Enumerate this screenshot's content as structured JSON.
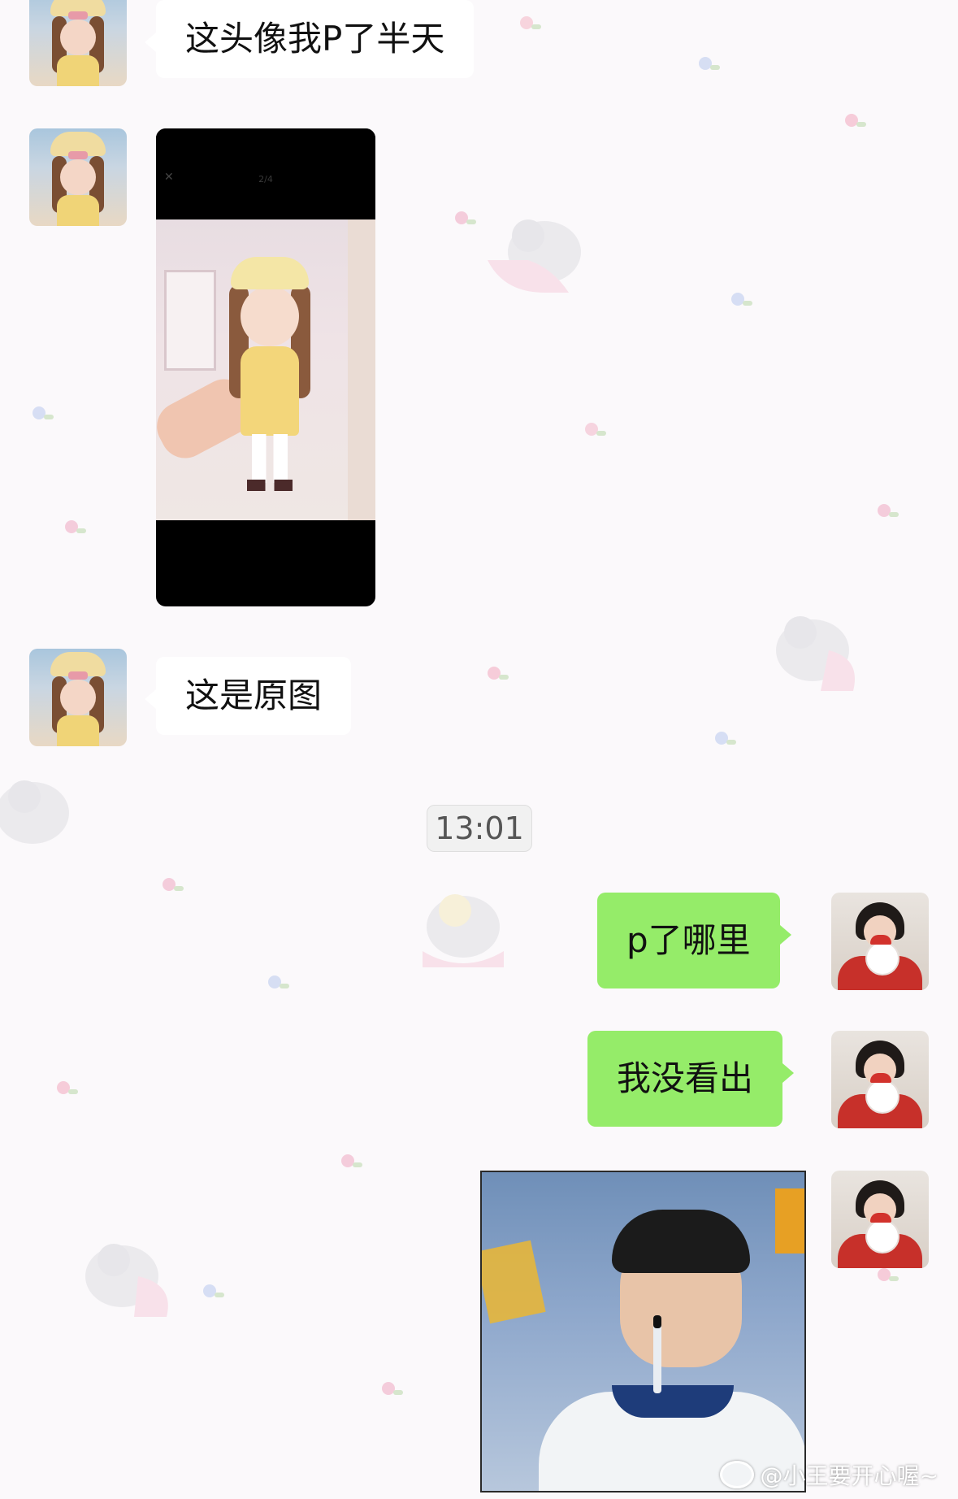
{
  "chat": {
    "messages": [
      {
        "from": "other",
        "type": "text",
        "text": "这头像我P了半天"
      },
      {
        "from": "other",
        "type": "image",
        "pager": "2/4"
      },
      {
        "from": "other",
        "type": "text",
        "text": "这是原图"
      },
      {
        "type": "timestamp",
        "text": "13:01"
      },
      {
        "from": "self",
        "type": "text",
        "text": "p了哪里"
      },
      {
        "from": "self",
        "type": "text",
        "text": "我没看出"
      },
      {
        "from": "self",
        "type": "image"
      }
    ]
  },
  "colors": {
    "outgoing_bubble": "#95ec69",
    "incoming_bubble": "#ffffff",
    "timestamp_bg": "#f0f0f0"
  },
  "icons": [
    "close-icon",
    "weibo-icon"
  ],
  "watermark": {
    "text": "@小王要开心喔~"
  }
}
